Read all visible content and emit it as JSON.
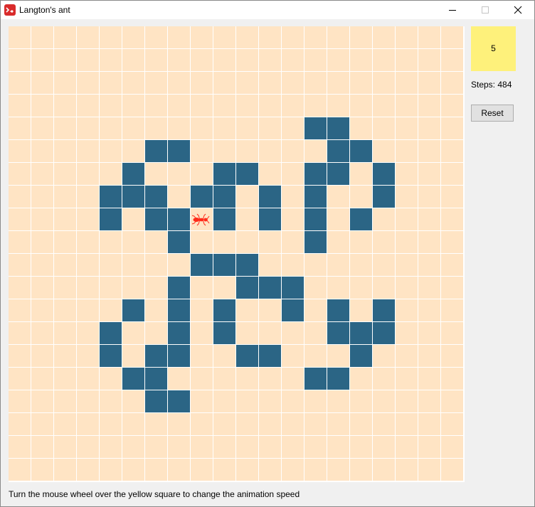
{
  "window": {
    "title": "Langton's ant",
    "app_icon": "langtons-ant-app-icon",
    "controls": [
      "minimize-icon",
      "maximize-icon",
      "close-icon"
    ]
  },
  "grid": {
    "columns": 20,
    "rows": 20,
    "colors": {
      "white_cell": "#ffe4c4",
      "black_cell": "#2b6585",
      "grid_line": "#ffffff",
      "ant": "#ff2a1a"
    },
    "black_cells": [
      [
        4,
        13
      ],
      [
        4,
        14
      ],
      [
        5,
        6
      ],
      [
        5,
        7
      ],
      [
        5,
        14
      ],
      [
        5,
        15
      ],
      [
        6,
        5
      ],
      [
        6,
        9
      ],
      [
        6,
        10
      ],
      [
        6,
        13
      ],
      [
        6,
        14
      ],
      [
        6,
        16
      ],
      [
        7,
        4
      ],
      [
        7,
        5
      ],
      [
        7,
        6
      ],
      [
        7,
        8
      ],
      [
        7,
        9
      ],
      [
        7,
        11
      ],
      [
        7,
        13
      ],
      [
        7,
        16
      ],
      [
        8,
        4
      ],
      [
        8,
        6
      ],
      [
        8,
        7
      ],
      [
        8,
        9
      ],
      [
        8,
        11
      ],
      [
        8,
        13
      ],
      [
        8,
        15
      ],
      [
        9,
        7
      ],
      [
        9,
        13
      ],
      [
        10,
        8
      ],
      [
        10,
        9
      ],
      [
        10,
        10
      ],
      [
        11,
        7
      ],
      [
        11,
        10
      ],
      [
        11,
        11
      ],
      [
        11,
        12
      ],
      [
        12,
        5
      ],
      [
        12,
        7
      ],
      [
        12,
        9
      ],
      [
        12,
        12
      ],
      [
        12,
        14
      ],
      [
        12,
        16
      ],
      [
        13,
        4
      ],
      [
        13,
        7
      ],
      [
        13,
        9
      ],
      [
        13,
        14
      ],
      [
        13,
        15
      ],
      [
        13,
        16
      ],
      [
        14,
        4
      ],
      [
        14,
        6
      ],
      [
        14,
        7
      ],
      [
        14,
        10
      ],
      [
        14,
        11
      ],
      [
        14,
        15
      ],
      [
        15,
        5
      ],
      [
        15,
        6
      ],
      [
        15,
        13
      ],
      [
        15,
        14
      ],
      [
        16,
        6
      ],
      [
        16,
        7
      ]
    ],
    "ant": {
      "row": 8,
      "col": 8,
      "heading": "east",
      "icon": "ant-icon"
    }
  },
  "sidebar": {
    "speed": "5",
    "speed_color": "#fef17b",
    "steps_label": "Steps:",
    "steps_value": "484",
    "reset_label": "Reset"
  },
  "footer": {
    "hint": "Turn the mouse wheel over the yellow square to change the animation speed"
  }
}
